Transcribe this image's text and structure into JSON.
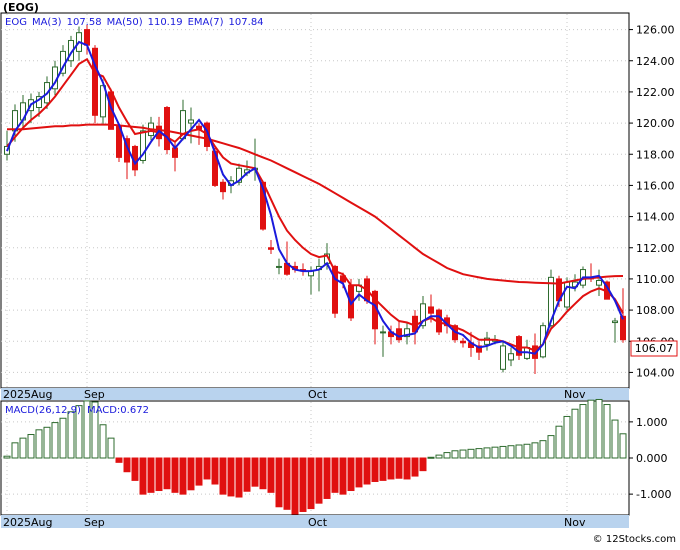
{
  "ticker": "(EOG)",
  "copyright": "© 12Stocks.com",
  "legend": {
    "symbol": "EOG",
    "ma3_label": "MA(3)",
    "ma3_value": "107.58",
    "ma50_label": "MA(50)",
    "ma50_value": "110.19",
    "ema7_label": "EMA(7)",
    "ema7_value": "107.84"
  },
  "macd_legend": {
    "label": "MACD(26,12,9)",
    "value_label": "MACD:0.672"
  },
  "last_price_label": "106.07",
  "x_labels": [
    "2025Aug",
    "Sep",
    "Oct",
    "Nov"
  ],
  "colors": {
    "up": "#2e6b2e",
    "down": "#e01010",
    "ma3": "#1a1adc",
    "ma50": "#e01010",
    "ema7": "#e01010",
    "axis_band": "#b9d3ee"
  },
  "chart_data": [
    {
      "type": "candlestick",
      "ylim": [
        103,
        127
      ],
      "y_ticks": [
        104,
        106,
        108,
        110,
        112,
        114,
        116,
        118,
        120,
        122,
        124,
        126
      ],
      "y_tick_labels": [
        "104.00",
        "106.00",
        "108.00",
        "110.00",
        "112.00",
        "114.00",
        "116.00",
        "118.00",
        "120.00",
        "122.00",
        "124.00",
        "126.00"
      ],
      "ohlc": [
        [
          118.0,
          119.5,
          117.6,
          118.5
        ],
        [
          119.5,
          121.2,
          118.8,
          120.8
        ],
        [
          120.2,
          121.8,
          119.6,
          121.3
        ],
        [
          120.8,
          121.9,
          120.0,
          121.5
        ],
        [
          121.0,
          122.0,
          120.4,
          121.7
        ],
        [
          121.3,
          123.0,
          120.9,
          122.6
        ],
        [
          122.2,
          124.0,
          121.8,
          123.6
        ],
        [
          123.2,
          125.0,
          123.0,
          124.6
        ],
        [
          124.0,
          125.6,
          123.6,
          125.3
        ],
        [
          124.6,
          126.2,
          124.0,
          125.8
        ],
        [
          126.0,
          126.3,
          124.4,
          125.0
        ],
        [
          124.8,
          125.0,
          120.0,
          120.5
        ],
        [
          120.4,
          122.8,
          119.9,
          122.4
        ],
        [
          122.0,
          122.2,
          119.6,
          119.6
        ],
        [
          119.8,
          120.0,
          117.5,
          117.8
        ],
        [
          119.0,
          119.2,
          116.4,
          117.5
        ],
        [
          118.5,
          118.6,
          116.6,
          117.0
        ],
        [
          117.6,
          119.9,
          117.4,
          119.5
        ],
        [
          119.2,
          120.4,
          118.9,
          120.0
        ],
        [
          119.8,
          120.4,
          118.5,
          119.0
        ],
        [
          121.0,
          121.1,
          118.0,
          118.3
        ],
        [
          118.4,
          118.8,
          116.9,
          117.8
        ],
        [
          119.0,
          121.5,
          118.9,
          120.8
        ],
        [
          120.0,
          121.0,
          118.7,
          120.2
        ],
        [
          119.8,
          120.0,
          118.6,
          119.6
        ],
        [
          120.0,
          120.1,
          118.2,
          118.5
        ],
        [
          118.2,
          118.4,
          115.9,
          116.0
        ],
        [
          116.2,
          116.4,
          115.1,
          115.6
        ],
        [
          116.0,
          116.6,
          115.5,
          116.3
        ],
        [
          116.2,
          117.4,
          116.0,
          117.1
        ],
        [
          116.8,
          117.6,
          116.6,
          117.0
        ],
        [
          117.0,
          119.0,
          116.3,
          117.1
        ],
        [
          116.2,
          116.3,
          113.1,
          113.2
        ],
        [
          112.0,
          112.5,
          111.6,
          111.9
        ],
        [
          110.8,
          111.3,
          110.3,
          110.8
        ],
        [
          111.0,
          112.4,
          110.2,
          110.3
        ],
        [
          110.8,
          111.1,
          110.4,
          110.6
        ],
        [
          110.6,
          111.0,
          110.2,
          110.5
        ],
        [
          110.2,
          110.8,
          109.0,
          110.5
        ],
        [
          110.6,
          111.3,
          109.2,
          110.8
        ],
        [
          111.0,
          112.3,
          110.6,
          111.6
        ],
        [
          110.8,
          110.9,
          107.5,
          107.8
        ],
        [
          110.2,
          110.4,
          109.4,
          109.8
        ],
        [
          109.6,
          110.0,
          107.3,
          107.5
        ],
        [
          109.2,
          110.0,
          108.6,
          109.6
        ],
        [
          110.0,
          110.2,
          108.4,
          108.6
        ],
        [
          109.2,
          109.3,
          105.8,
          106.8
        ],
        [
          106.6,
          107.0,
          105.0,
          106.6
        ],
        [
          106.6,
          107.0,
          105.8,
          106.3
        ],
        [
          106.8,
          107.3,
          105.9,
          106.1
        ],
        [
          106.3,
          107.2,
          105.8,
          106.8
        ],
        [
          107.6,
          108.0,
          105.8,
          106.6
        ],
        [
          107.0,
          108.9,
          106.8,
          108.4
        ],
        [
          108.2,
          109.0,
          107.2,
          107.8
        ],
        [
          108.0,
          108.1,
          106.4,
          106.6
        ],
        [
          107.5,
          107.7,
          106.5,
          107.0
        ],
        [
          107.0,
          107.1,
          105.9,
          106.1
        ],
        [
          106.0,
          106.2,
          105.6,
          105.9
        ],
        [
          105.9,
          106.6,
          105.0,
          105.6
        ],
        [
          105.7,
          106.0,
          104.8,
          105.3
        ],
        [
          105.8,
          106.6,
          105.4,
          106.2
        ],
        [
          106.0,
          106.4,
          105.8,
          106.1
        ],
        [
          104.2,
          106.0,
          104.0,
          105.7
        ],
        [
          104.8,
          105.6,
          104.4,
          105.2
        ],
        [
          106.3,
          106.4,
          104.8,
          105.1
        ],
        [
          104.9,
          106.1,
          104.8,
          105.6
        ],
        [
          105.7,
          106.5,
          103.9,
          104.9
        ],
        [
          105.0,
          107.2,
          104.9,
          107.0
        ],
        [
          107.0,
          110.6,
          106.8,
          110.1
        ],
        [
          110.0,
          110.2,
          108.2,
          108.6
        ],
        [
          108.2,
          110.1,
          108.0,
          109.8
        ],
        [
          109.5,
          110.3,
          109.2,
          109.8
        ],
        [
          109.6,
          110.8,
          109.4,
          110.6
        ],
        [
          110.1,
          111.0,
          109.8,
          110.0
        ],
        [
          109.6,
          110.6,
          108.9,
          109.9
        ],
        [
          109.8,
          109.9,
          108.8,
          108.7
        ],
        [
          107.2,
          107.5,
          105.9,
          107.3
        ],
        [
          107.6,
          109.4,
          105.9,
          106.1
        ]
      ],
      "ma3": [
        118.2,
        119.5,
        120.2,
        121.2,
        121.5,
        121.9,
        122.6,
        123.6,
        124.5,
        125.2,
        125.0,
        123.7,
        122.6,
        121.0,
        119.9,
        118.5,
        117.4,
        118.0,
        118.8,
        119.5,
        119.1,
        118.4,
        119.0,
        119.6,
        120.2,
        119.5,
        118.1,
        116.7,
        116.0,
        116.3,
        116.8,
        117.1,
        115.8,
        114.1,
        111.9,
        111.0,
        110.6,
        110.5,
        110.5,
        110.6,
        111.0,
        110.0,
        109.7,
        108.4,
        109.0,
        108.6,
        108.3,
        107.3,
        106.6,
        106.3,
        106.4,
        106.5,
        107.3,
        107.6,
        107.6,
        107.1,
        106.6,
        106.4,
        105.9,
        105.6,
        105.7,
        105.9,
        106.0,
        105.7,
        105.3,
        105.3,
        105.2,
        105.8,
        107.3,
        108.6,
        109.5,
        109.4,
        110.1,
        110.1,
        110.2,
        109.5,
        108.6,
        107.4
      ],
      "ema7": [
        118.5,
        119.1,
        119.7,
        120.2,
        120.6,
        121.1,
        121.7,
        122.4,
        123.1,
        123.8,
        124.1,
        123.2,
        123.0,
        122.1,
        121.0,
        120.1,
        119.3,
        119.4,
        119.5,
        119.4,
        119.1,
        118.8,
        119.3,
        119.5,
        119.6,
        119.3,
        118.5,
        117.8,
        117.4,
        117.3,
        117.2,
        117.1,
        116.2,
        115.1,
        114.0,
        113.1,
        112.5,
        112.0,
        111.6,
        111.4,
        111.5,
        110.5,
        110.3,
        109.6,
        109.6,
        109.3,
        108.7,
        108.2,
        107.7,
        107.3,
        107.2,
        107.0,
        107.3,
        107.5,
        107.2,
        107.1,
        106.9,
        106.7,
        106.4,
        106.1,
        106.1,
        106.1,
        106.0,
        105.8,
        105.6,
        105.6,
        105.4,
        105.8,
        106.8,
        107.3,
        107.9,
        108.4,
        108.9,
        109.2,
        109.4,
        109.2,
        108.7,
        107.8
      ],
      "ma50": [
        119.6,
        119.6,
        119.6,
        119.65,
        119.7,
        119.75,
        119.8,
        119.8,
        119.85,
        119.85,
        119.9,
        119.9,
        119.9,
        119.9,
        119.85,
        119.8,
        119.75,
        119.7,
        119.6,
        119.55,
        119.5,
        119.4,
        119.3,
        119.2,
        119.1,
        119.0,
        118.85,
        118.7,
        118.55,
        118.4,
        118.2,
        118.0,
        117.8,
        117.6,
        117.35,
        117.1,
        116.85,
        116.6,
        116.35,
        116.1,
        115.8,
        115.5,
        115.2,
        114.9,
        114.6,
        114.3,
        114.0,
        113.6,
        113.2,
        112.8,
        112.4,
        112.0,
        111.6,
        111.3,
        111.0,
        110.7,
        110.5,
        110.3,
        110.2,
        110.1,
        110.0,
        109.95,
        109.9,
        109.85,
        109.8,
        109.78,
        109.76,
        109.74,
        109.72,
        109.7,
        109.8,
        109.9,
        110.0,
        110.05,
        110.1,
        110.15,
        110.18,
        110.19
      ]
    },
    {
      "type": "bar",
      "ylim": [
        -1.55,
        1.55
      ],
      "y_ticks": [
        1.0,
        0.0,
        -1.0
      ],
      "y_tick_labels": [
        "1.000",
        "0.000",
        "-1.000"
      ],
      "values": [
        0.05,
        0.42,
        0.55,
        0.65,
        0.78,
        0.85,
        0.98,
        1.1,
        1.28,
        1.45,
        1.58,
        1.55,
        0.92,
        0.55,
        -0.12,
        -0.38,
        -0.62,
        -1.0,
        -0.95,
        -0.9,
        -0.85,
        -0.95,
        -1.0,
        -0.88,
        -0.75,
        -0.58,
        -0.72,
        -1.0,
        -1.05,
        -1.08,
        -0.92,
        -0.78,
        -0.85,
        -0.95,
        -1.35,
        -1.42,
        -1.55,
        -1.48,
        -1.4,
        -1.25,
        -1.12,
        -0.95,
        -1.0,
        -0.9,
        -0.8,
        -0.72,
        -0.65,
        -0.62,
        -0.58,
        -0.56,
        -0.58,
        -0.5,
        -0.35,
        0.02,
        0.08,
        0.15,
        0.2,
        0.22,
        0.24,
        0.26,
        0.28,
        0.3,
        0.32,
        0.34,
        0.36,
        0.38,
        0.42,
        0.48,
        0.62,
        0.88,
        1.15,
        1.35,
        1.48,
        1.6,
        1.62,
        1.48,
        1.05,
        0.67
      ]
    }
  ]
}
